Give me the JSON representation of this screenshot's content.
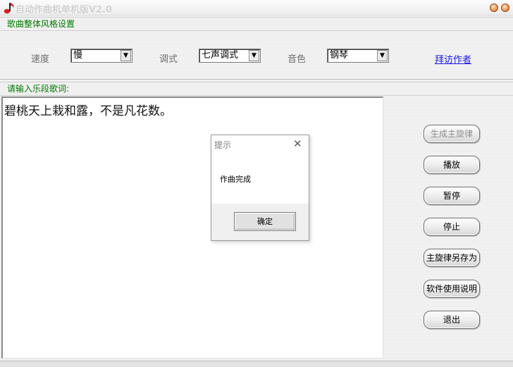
{
  "window": {
    "title": "自动作曲机单机版V2.0",
    "icon": "music-note-icon",
    "min_icon": "minimize-icon",
    "close_icon": "close-icon"
  },
  "style_section": {
    "heading": "歌曲整体风格设置",
    "speed": {
      "label": "速度",
      "value": "慢"
    },
    "mode": {
      "label": "调式",
      "value": "七声调式"
    },
    "timbre": {
      "label": "音色",
      "value": "钢琴"
    },
    "visit_link": "拜访作者"
  },
  "lyrics_section": {
    "heading": "请输入乐段歌词:",
    "text": "碧桃天上栽和露，不是凡花数。"
  },
  "actions": {
    "generate": "生成主旋律",
    "play": "播放",
    "pause": "暂停",
    "stop": "停止",
    "save_as": "主旋律另存为",
    "help": "软件使用说明",
    "exit": "退出"
  },
  "dialog": {
    "title": "提示",
    "message": "作曲完成",
    "ok": "确定"
  }
}
